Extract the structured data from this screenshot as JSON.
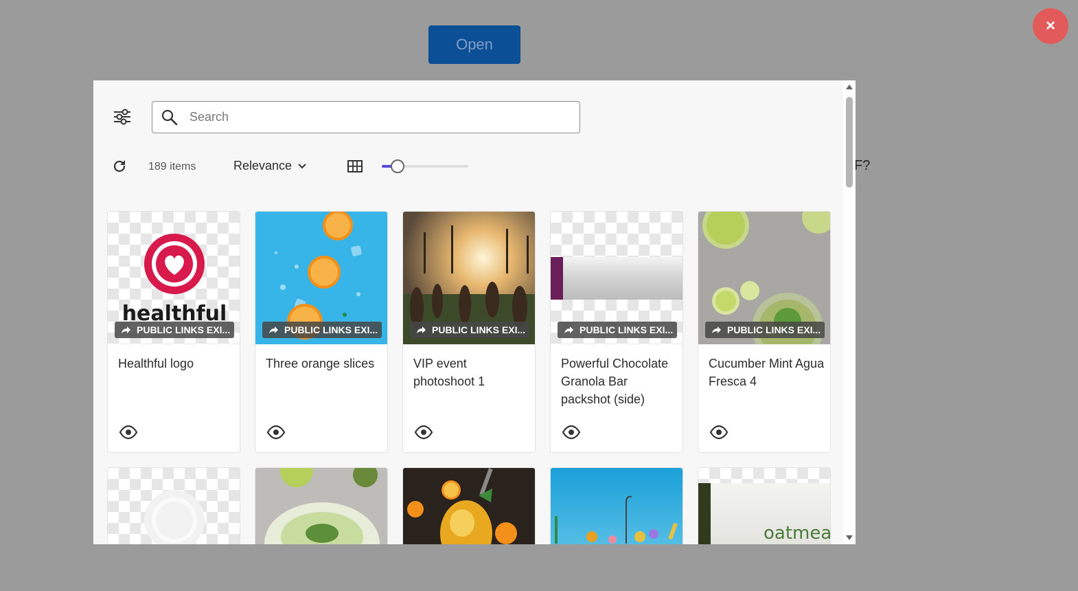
{
  "page": {
    "open_label": "Open",
    "close_label": "×",
    "background_fragment": "F?"
  },
  "toolbar": {
    "search_placeholder": "Search",
    "search_value": "",
    "item_count": "189 items",
    "sort_label": "Relevance",
    "thumbnail_size_fraction": 0.17
  },
  "colors": {
    "accent": "#5b4ce0",
    "open_button": "#0b4f96",
    "close_button": "#e25a5a"
  },
  "cards": [
    {
      "title": "Healthful logo",
      "badge": "PUBLIC LINKS EXI...",
      "thumb": "healthful-logo"
    },
    {
      "title": "Three orange slices",
      "badge": "PUBLIC LINKS EXI...",
      "thumb": "orange-slices"
    },
    {
      "title": "VIP event photoshoot 1",
      "badge": "PUBLIC LINKS EXI...",
      "thumb": "event-photo"
    },
    {
      "title": "Powerful Chocolate Granola Bar packshot (side)",
      "badge": "PUBLIC LINKS EXI...",
      "thumb": "granola-bar"
    },
    {
      "title": "Cucumber Mint Agua Fresca 4",
      "badge": "PUBLIC LINKS EXI...",
      "thumb": "cucumber-drink"
    },
    {
      "title": "",
      "thumb": "logo-white"
    },
    {
      "title": "",
      "thumb": "lime-bowl"
    },
    {
      "title": "",
      "thumb": "orange-cocktail"
    },
    {
      "title": "",
      "thumb": "pier-toys"
    },
    {
      "title": "",
      "thumb": "oatmeal-pack",
      "thumb_text": "oatmea"
    }
  ]
}
